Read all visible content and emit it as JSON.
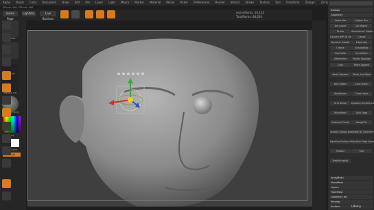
{
  "menubar": {
    "items": [
      "Alpha",
      "Brush",
      "Color",
      "Document",
      "Draw",
      "Edit",
      "File",
      "Layer",
      "Light",
      "Macro",
      "Marker",
      "Material",
      "Movie",
      "Picker",
      "Preferences",
      "Render",
      "Stencil",
      "Stroke",
      "Texture",
      "Tool",
      "Transform",
      "Zplugin",
      "Zscript"
    ]
  },
  "info": {
    "line1": "ZBrush 4R6 / ZBrush 4R6"
  },
  "topshelf": {
    "home_label": "Home Page",
    "lightbox_label": "LightBox",
    "live_boolean_label": "Live Boolean",
    "draw_label": "Draw",
    "move_label": "Move",
    "scale_label": "Scale",
    "rotate_label": "Rotate",
    "active_points": "ActivePoints: 10,152",
    "total_points": "TotalPoints: 88,620"
  },
  "left": {
    "transpose_label": "Transpose",
    "dots_label": "Dots",
    "alpha_label": "Alpha Off",
    "texture_label": "Texture Off",
    "material_label": "MatCap Gray",
    "gradient_label": "Gradient",
    "switch_label": "SwitchColor",
    "alternate_label": "Alternate"
  },
  "panel": {
    "subtool_label": "Subtool",
    "geometry_label": "Geometry",
    "rows": [
      "Lower Res",
      "Higher Res",
      "Del Lower",
      "Del Higher",
      "Divide",
      "Reconstruct Subdiv",
      "Convert BPR To Geo",
      "Crease",
      "Dynamic Subdiv",
      "EdgeLoop",
      "Crease",
      "ShadowBox",
      "ClayPolish",
      "DynaMesh",
      "ZRemesher",
      "Modify Topology"
    ],
    "modify_rows": [
      "Copy",
      "Paste Append",
      "Paste Replace",
      "Mirror And Weld",
      "Del Hidden",
      "Insert Mesh",
      "WeldPoints",
      "Close Holes",
      "Grid Divide",
      "Equalize Surface Area",
      "MicroMesh",
      "Spin Edge",
      "Optimize Points",
      "MergeTris",
      "Unweld Groups Border",
      "Delete By Symmetry",
      "Equalize Surface Area",
      "Equalize Edge Length",
      "Position",
      "Size",
      "MeshIntegrity"
    ],
    "sub_items": [
      "ArrayMesh",
      "NanoMesh",
      "Layers",
      "FiberMesh",
      "Geometry HD",
      "Preview",
      "Surface"
    ]
  },
  "watermark": "Udemy"
}
